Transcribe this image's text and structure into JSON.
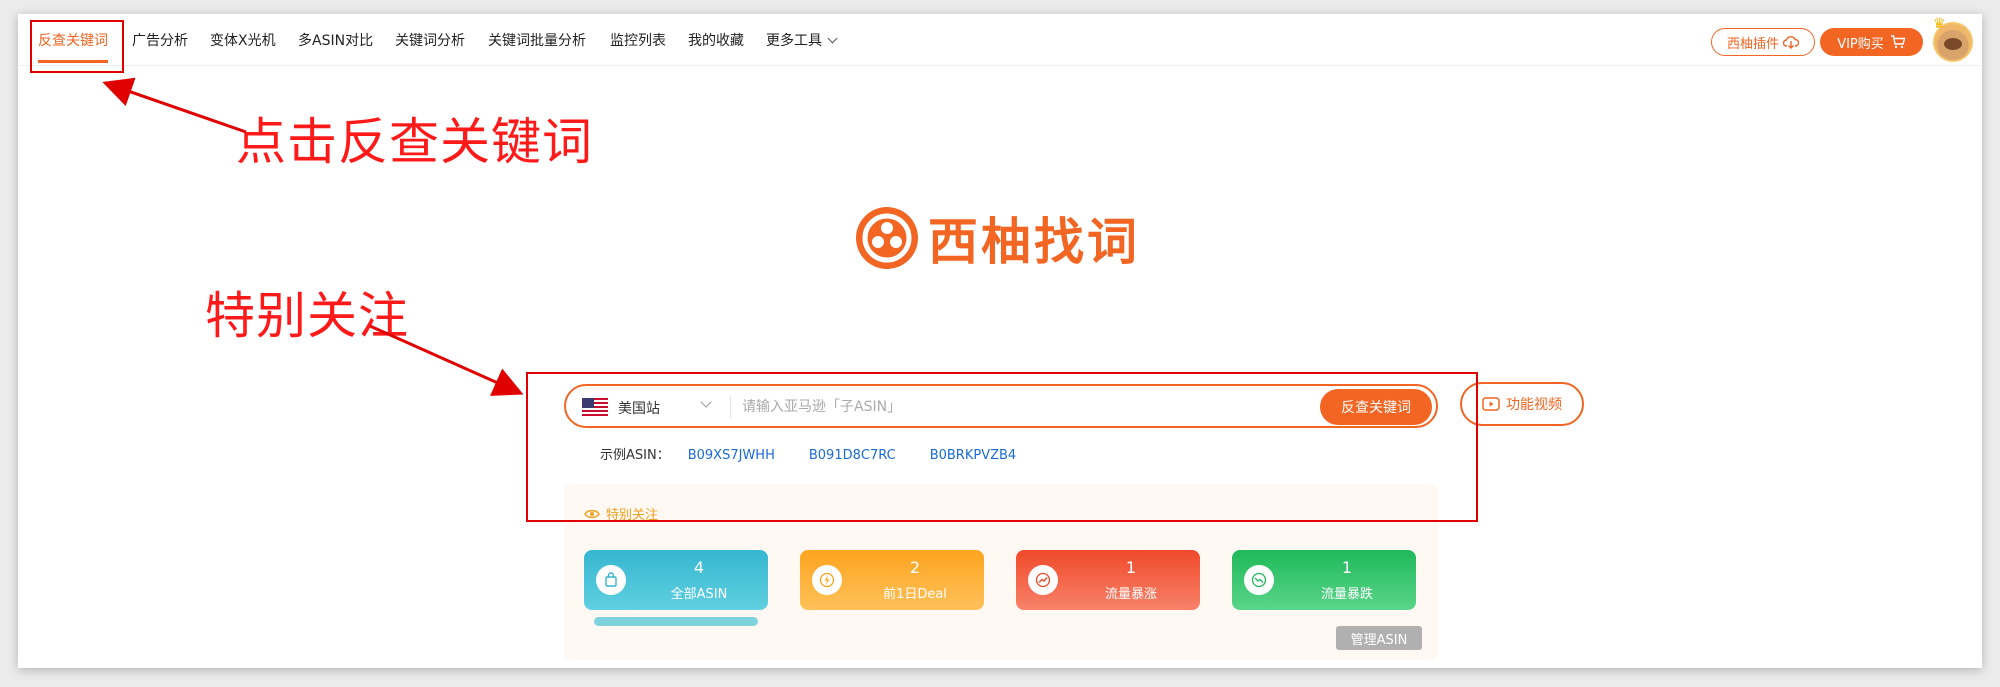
{
  "nav": {
    "items": [
      {
        "label": "反查关键词",
        "active": true
      },
      {
        "label": "广告分析"
      },
      {
        "label": "变体X光机"
      },
      {
        "label": "多ASIN对比"
      },
      {
        "label": "关键词分析"
      },
      {
        "label": "关键词批量分析"
      },
      {
        "label": "监控列表"
      },
      {
        "label": "我的收藏"
      },
      {
        "label": "更多工具"
      }
    ],
    "plugin_label": "西柚插件",
    "vip_label": "VIP购买"
  },
  "annotations": {
    "step1": "点击反查关键词",
    "step2": "特别关注",
    "color": "#ff1a1a"
  },
  "logo": {
    "text": "西柚找词",
    "color": "#f26522"
  },
  "search": {
    "site": "美国站",
    "placeholder": "请输入亚马逊「子ASIN」",
    "button": "反查关键词",
    "video_button": "功能视频"
  },
  "examples": {
    "label": "示例ASIN：",
    "asins": [
      "B09XS7JWHH",
      "B091D8C7RC",
      "B0BRKPVZB4"
    ]
  },
  "watch": {
    "title": "特别关注",
    "cards": [
      {
        "count": "4",
        "label": "全部ASIN",
        "icon": "shopping-bag-icon",
        "color": "#36b6d0"
      },
      {
        "count": "2",
        "label": "前1日Deal",
        "icon": "lightning-icon",
        "color": "#fda41e"
      },
      {
        "count": "1",
        "label": "流量暴涨",
        "icon": "trend-up-icon",
        "color": "#f0492a"
      },
      {
        "count": "1",
        "label": "流量暴跌",
        "icon": "trend-down-icon",
        "color": "#1fb95a"
      }
    ],
    "manage": "管理ASIN"
  },
  "accent": "#f26522"
}
